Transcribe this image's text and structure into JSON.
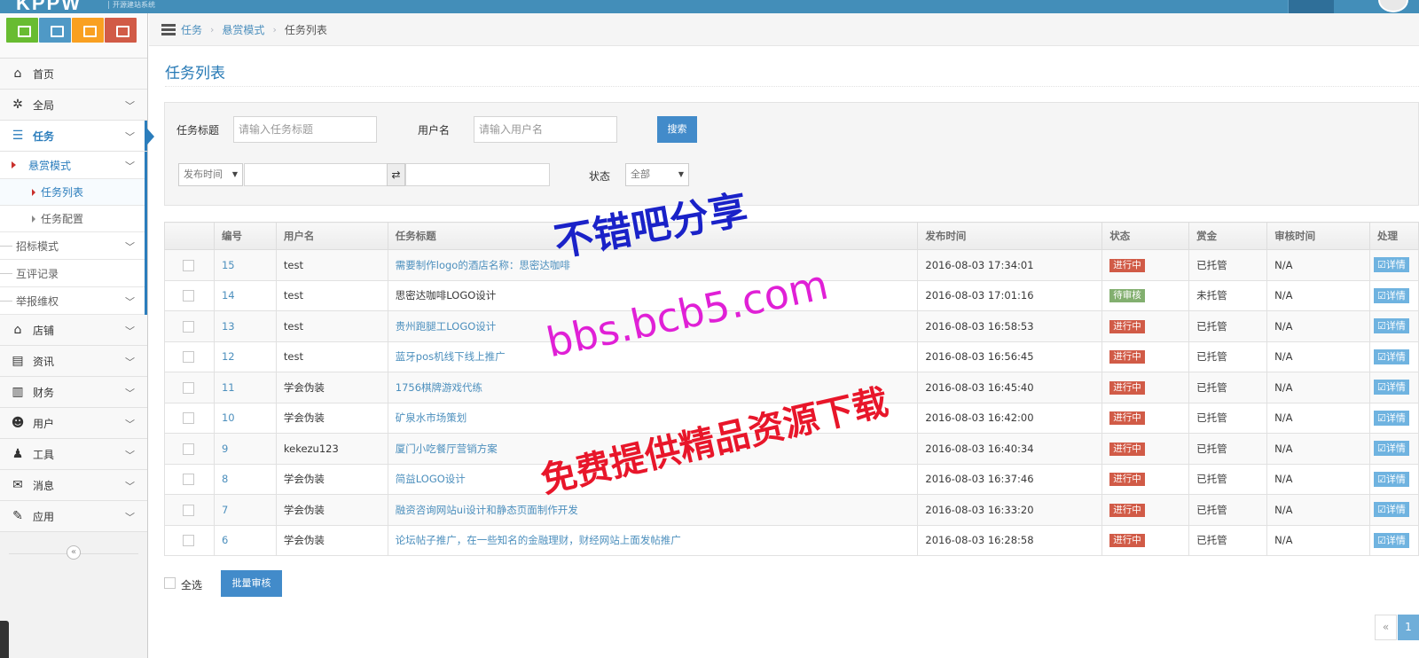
{
  "app": {
    "logo": "KPPW",
    "logo_sub": "开源建站系统"
  },
  "shortcuts": [
    "chart-icon",
    "list-icon",
    "users-icon",
    "gears-icon"
  ],
  "sidebar": {
    "items": [
      {
        "label": "首页",
        "icon": "home-icon",
        "glyph": "⌂"
      },
      {
        "label": "全局",
        "icon": "gear-icon",
        "glyph": "✲"
      },
      {
        "label": "任务",
        "icon": "task-icon",
        "glyph": "☰",
        "active": true
      },
      {
        "label": "店铺",
        "icon": "home-icon",
        "glyph": "⌂"
      },
      {
        "label": "资讯",
        "icon": "file-icon",
        "glyph": "▤"
      },
      {
        "label": "财务",
        "icon": "bar-chart-icon",
        "glyph": "▥"
      },
      {
        "label": "用户",
        "icon": "users-icon",
        "glyph": "☻"
      },
      {
        "label": "工具",
        "icon": "user-icon",
        "glyph": "♟"
      },
      {
        "label": "消息",
        "icon": "envelope-icon",
        "glyph": "✉"
      },
      {
        "label": "应用",
        "icon": "edit-icon",
        "glyph": "✎"
      }
    ],
    "task_sub": {
      "reward_mode": "悬赏模式",
      "task_list": "任务列表",
      "task_config": "任务配置",
      "bid_mode": "招标模式",
      "review_log": "互评记录",
      "report": "举报维权"
    },
    "collapse_glyph": "«"
  },
  "breadcrumb": {
    "level1": "任务",
    "level2": "悬赏模式",
    "current": "任务列表",
    "separator": "›"
  },
  "page_title": "任务列表",
  "search": {
    "title_label": "任务标题",
    "title_placeholder": "请输入任务标题",
    "user_label": "用户名",
    "user_placeholder": "请输入用户名",
    "search_button": "搜索",
    "time_select": "发布时间",
    "swap_glyph": "⇄",
    "status_label": "状态",
    "status_select": "全部",
    "caret": "▼"
  },
  "table": {
    "headers": [
      "",
      "编号",
      "用户名",
      "任务标题",
      "发布时间",
      "状态",
      "赏金",
      "审核时间",
      "处理"
    ],
    "detail_label": "☑详情",
    "rows": [
      {
        "id": "15",
        "user": "test",
        "title": "需要制作logo的酒店名称：思密达咖啡",
        "time": "2016-08-03 17:34:01",
        "status": "进行中",
        "status_type": "red",
        "reward": "已托管",
        "audit": "N/A",
        "title_link": true
      },
      {
        "id": "14",
        "user": "test",
        "title": "思密达咖啡LOGO设计",
        "time": "2016-08-03 17:01:16",
        "status": "待审核",
        "status_type": "green",
        "reward": "未托管",
        "audit": "N/A",
        "title_link": false
      },
      {
        "id": "13",
        "user": "test",
        "title": "贵州跑腿工LOGO设计",
        "time": "2016-08-03 16:58:53",
        "status": "进行中",
        "status_type": "red",
        "reward": "已托管",
        "audit": "N/A",
        "title_link": true
      },
      {
        "id": "12",
        "user": "test",
        "title": "蓝牙pos机线下线上推广",
        "time": "2016-08-03 16:56:45",
        "status": "进行中",
        "status_type": "red",
        "reward": "已托管",
        "audit": "N/A",
        "title_link": true
      },
      {
        "id": "11",
        "user": "学会伪装",
        "title": "1756棋牌游戏代练",
        "time": "2016-08-03 16:45:40",
        "status": "进行中",
        "status_type": "red",
        "reward": "已托管",
        "audit": "N/A",
        "title_link": true
      },
      {
        "id": "10",
        "user": "学会伪装",
        "title": "矿泉水市场策划",
        "time": "2016-08-03 16:42:00",
        "status": "进行中",
        "status_type": "red",
        "reward": "已托管",
        "audit": "N/A",
        "title_link": true
      },
      {
        "id": "9",
        "user": "kekezu123",
        "title": "厦门小吃餐厅营销方案",
        "time": "2016-08-03 16:40:34",
        "status": "进行中",
        "status_type": "red",
        "reward": "已托管",
        "audit": "N/A",
        "title_link": true
      },
      {
        "id": "8",
        "user": "学会伪装",
        "title": "简益LOGO设计",
        "time": "2016-08-03 16:37:46",
        "status": "进行中",
        "status_type": "red",
        "reward": "已托管",
        "audit": "N/A",
        "title_link": true
      },
      {
        "id": "7",
        "user": "学会伪装",
        "title": "融资咨询网站ui设计和静态页面制作开发",
        "time": "2016-08-03 16:33:20",
        "status": "进行中",
        "status_type": "red",
        "reward": "已托管",
        "audit": "N/A",
        "title_link": true
      },
      {
        "id": "6",
        "user": "学会伪装",
        "title": "论坛帖子推广，在一些知名的金融理财，财经网站上面发帖推广",
        "time": "2016-08-03 16:28:58",
        "status": "进行中",
        "status_type": "red",
        "reward": "已托管",
        "audit": "N/A",
        "title_link": true
      }
    ]
  },
  "footer": {
    "select_all": "全选",
    "batch_audit": "批量审核"
  },
  "pagination": {
    "prev": "«",
    "current_page": "1"
  },
  "watermark": {
    "line1": "不错吧分享",
    "line2": "bbs.bcb5.com",
    "line3": "免费提供精品资源下载"
  },
  "colors": {
    "primary": "#438eb9",
    "link": "#4c8fbd",
    "danger": "#d15b47",
    "success": "#82af6f",
    "info": "#6fb3e0"
  }
}
